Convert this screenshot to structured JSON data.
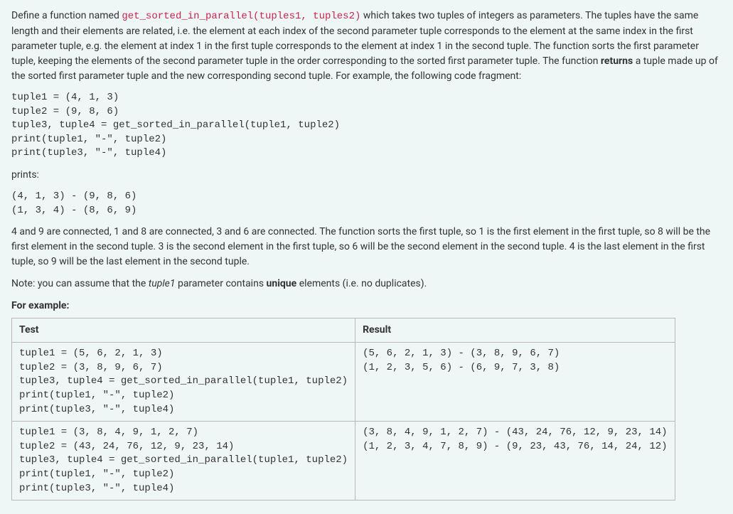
{
  "intro": {
    "prefix": "Define a function named ",
    "func_sig": "get_sorted_in_parallel(tuples1, tuples2)",
    "body1": " which takes two tuples of integers as parameters. The tuples have the same length and their elements are related, i.e. the element at each index of the second parameter tuple corresponds to the element at the same index in the first parameter tuple, e.g. the element at index 1 in the first tuple corresponds to the element at index 1 in the second tuple. The function sorts the first parameter tuple, keeping the elements of the second parameter tuple in the order corresponding to the sorted first parameter tuple. The function ",
    "returns_word": "returns",
    "body2": " a tuple made up of the sorted first parameter tuple and the new corresponding second tuple. For example, the following code fragment:"
  },
  "code_fragment": "tuple1 = (4, 1, 3)\ntuple2 = (9, 8, 6)\ntuple3, tuple4 = get_sorted_in_parallel(tuple1, tuple2)\nprint(tuple1, \"-\", tuple2)\nprint(tuple3, \"-\", tuple4)",
  "prints_label": "prints:",
  "prints_output": "(4, 1, 3) - (9, 8, 6)\n(1, 3, 4) - (8, 6, 9)",
  "explanation": "4 and 9 are connected, 1 and 8 are connected, 3 and 6 are connected. The function sorts the first tuple, so 1 is the first element in the first tuple, so 8 will be the first element in the second tuple. 3 is the second element in the first tuple, so 6 will be the second element in the second tuple. 4 is the last element in the first tuple, so 9 will be the last element in the second tuple.",
  "note": {
    "prefix": "Note: you can assume that the ",
    "italic": "tuple1",
    "mid": " parameter contains ",
    "bold": "unique",
    "suffix": " elements (i.e. no duplicates)."
  },
  "for_example_label": "For example:",
  "table": {
    "headers": {
      "test": "Test",
      "result": "Result"
    },
    "rows": [
      {
        "test": "tuple1 = (5, 6, 2, 1, 3)\ntuple2 = (3, 8, 9, 6, 7)\ntuple3, tuple4 = get_sorted_in_parallel(tuple1, tuple2)\nprint(tuple1, \"-\", tuple2)\nprint(tuple3, \"-\", tuple4)",
        "result": "(5, 6, 2, 1, 3) - (3, 8, 9, 6, 7)\n(1, 2, 3, 5, 6) - (6, 9, 7, 3, 8)"
      },
      {
        "test": "tuple1 = (3, 8, 4, 9, 1, 2, 7)\ntuple2 = (43, 24, 76, 12, 9, 23, 14)\ntuple3, tuple4 = get_sorted_in_parallel(tuple1, tuple2)\nprint(tuple1, \"-\", tuple2)\nprint(tuple3, \"-\", tuple4)",
        "result": "(3, 8, 4, 9, 1, 2, 7) - (43, 24, 76, 12, 9, 23, 14)\n(1, 2, 3, 4, 7, 8, 9) - (9, 23, 43, 76, 14, 24, 12)"
      }
    ]
  }
}
